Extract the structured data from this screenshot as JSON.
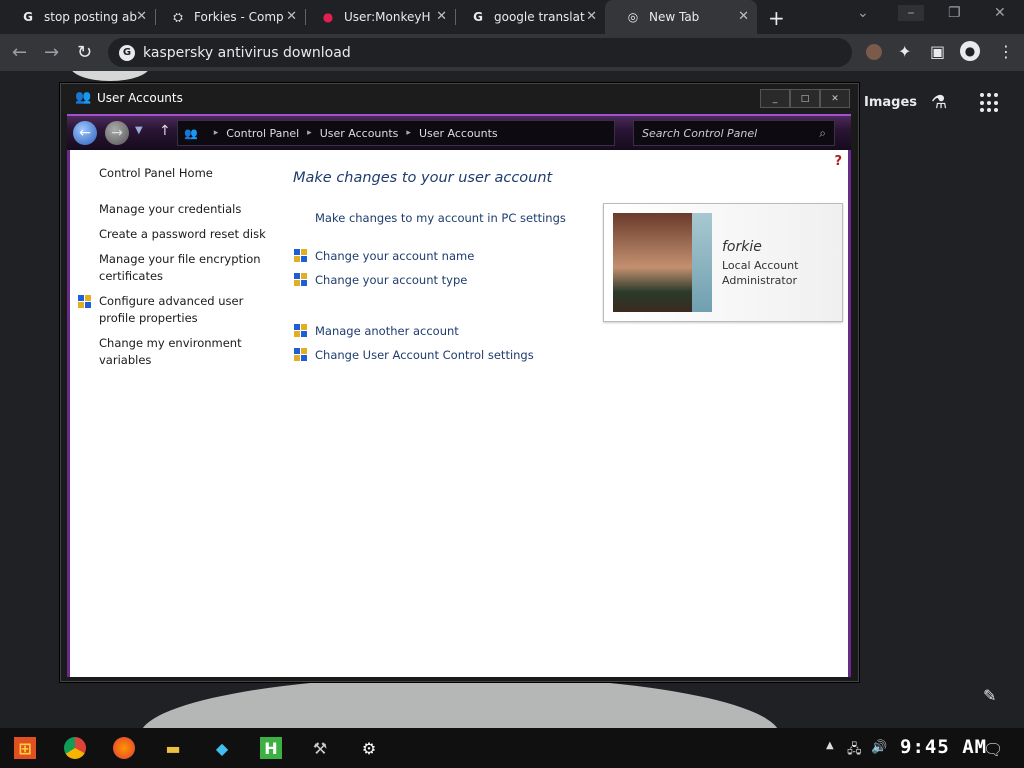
{
  "browser": {
    "tabs": [
      {
        "title": "stop posting ab",
        "icon": "google-icon"
      },
      {
        "title": "Forkies - Comp",
        "icon": "fandom-icon"
      },
      {
        "title": "User:MonkeyH",
        "icon": "flame-icon"
      },
      {
        "title": "google translat",
        "icon": "google-icon"
      },
      {
        "title": "New Tab",
        "icon": "chrome-icon"
      }
    ],
    "omnibox": {
      "text": "kaspersky antivirus download"
    },
    "page_links": {
      "images": "Images"
    }
  },
  "window": {
    "title": "User Accounts",
    "breadcrumb": [
      "Control Panel",
      "User Accounts",
      "User Accounts"
    ],
    "search_placeholder": "Search Control Panel",
    "help": "?",
    "sidebar": [
      "Control Panel Home",
      "Manage your credentials",
      "Create a password reset disk",
      "Manage your file encryption certificates",
      "Configure advanced user profile properties",
      "Change my environment variables"
    ],
    "heading": "Make changes to your user account",
    "links": [
      "Make changes to my account in PC settings",
      "Change your account name",
      "Change your account type",
      "Manage another account",
      "Change User Account Control settings"
    ],
    "account": {
      "name": "forkie",
      "type": "Local Account",
      "role": "Administrator"
    }
  },
  "taskbar": {
    "clock": "9:45 AM"
  },
  "colors": {
    "accent": "#6a2a8a",
    "link": "#1e3c6e"
  }
}
